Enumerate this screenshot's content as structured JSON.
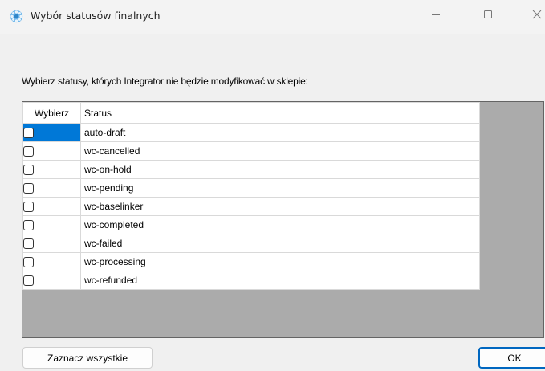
{
  "window": {
    "title": "Wybór statusów finalnych",
    "icon": "gear-icon",
    "controls": [
      "minimize-icon",
      "maximize-icon",
      "close-icon"
    ]
  },
  "prompt": "Wybierz statusy, których Integrator nie będzie modyfikować w sklepie:",
  "grid": {
    "columns": [
      "Wybierz",
      "Status"
    ],
    "rows": [
      {
        "checked": false,
        "status": "auto-draft",
        "selected": true
      },
      {
        "checked": false,
        "status": "wc-cancelled",
        "selected": false
      },
      {
        "checked": false,
        "status": "wc-on-hold",
        "selected": false
      },
      {
        "checked": false,
        "status": "wc-pending",
        "selected": false
      },
      {
        "checked": false,
        "status": "wc-baselinker",
        "selected": false
      },
      {
        "checked": false,
        "status": "wc-completed",
        "selected": false
      },
      {
        "checked": false,
        "status": "wc-failed",
        "selected": false
      },
      {
        "checked": false,
        "status": "wc-processing",
        "selected": false
      },
      {
        "checked": false,
        "status": "wc-refunded",
        "selected": false
      }
    ]
  },
  "buttons": {
    "select_all": "Zaznacz wszystkie",
    "ok": "OK"
  },
  "colors": {
    "selection": "#0078d7",
    "grid_background": "#ababab",
    "ok_border": "#0067c0"
  }
}
